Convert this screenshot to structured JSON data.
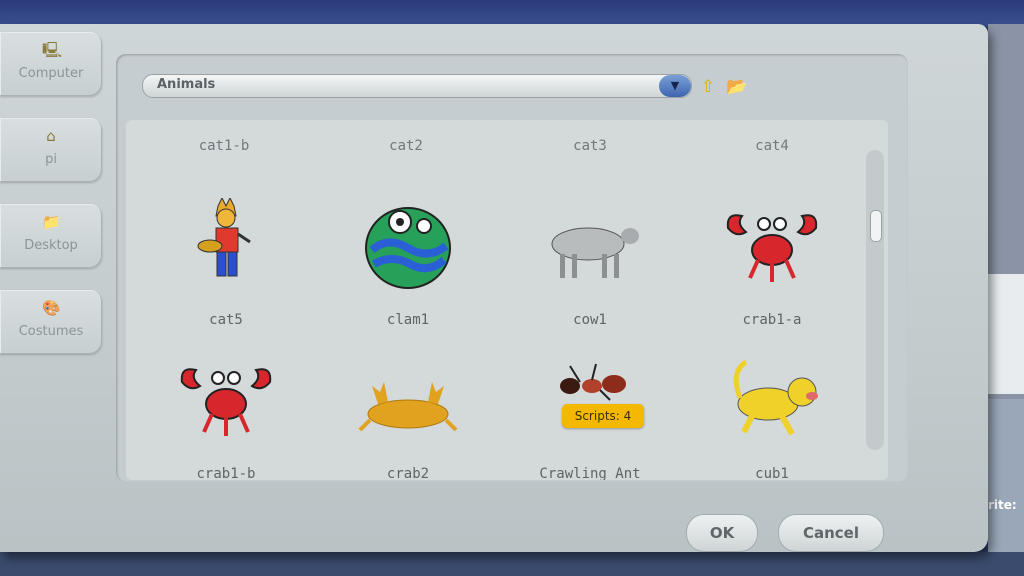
{
  "places": [
    {
      "label": "Computer",
      "icon": "computer-icon"
    },
    {
      "label": "pi",
      "icon": "home-icon"
    },
    {
      "label": "Desktop",
      "icon": "folder-icon"
    },
    {
      "label": "Costumes",
      "icon": "costumes-icon"
    }
  ],
  "browser": {
    "path_value": "Animals",
    "up_icon": "up-arrow-icon",
    "new_folder_icon": "new-folder-icon"
  },
  "top_row_labels": [
    "cat1-b",
    "cat2",
    "cat3",
    "cat4"
  ],
  "items": [
    {
      "name": "cat5",
      "icon": "cat-icon"
    },
    {
      "name": "clam1",
      "icon": "clam-icon"
    },
    {
      "name": "cow1",
      "icon": "cow-icon"
    },
    {
      "name": "crab1-a",
      "icon": "crab-icon"
    },
    {
      "name": "crab1-b",
      "icon": "crab-icon"
    },
    {
      "name": "crab2",
      "icon": "crab-icon"
    },
    {
      "name": "Crawling Ant",
      "icon": "ant-icon",
      "badge": "Scripts: 4"
    },
    {
      "name": "cub1",
      "icon": "lion-cub-icon"
    }
  ],
  "buttons": {
    "ok": "OK",
    "cancel": "Cancel"
  },
  "background": {
    "sprite_label_partial": "rite:"
  },
  "colors": {
    "badge": "#f5b800",
    "crab_red": "#d8272c",
    "dropdown_blue": "#3e66b0"
  }
}
